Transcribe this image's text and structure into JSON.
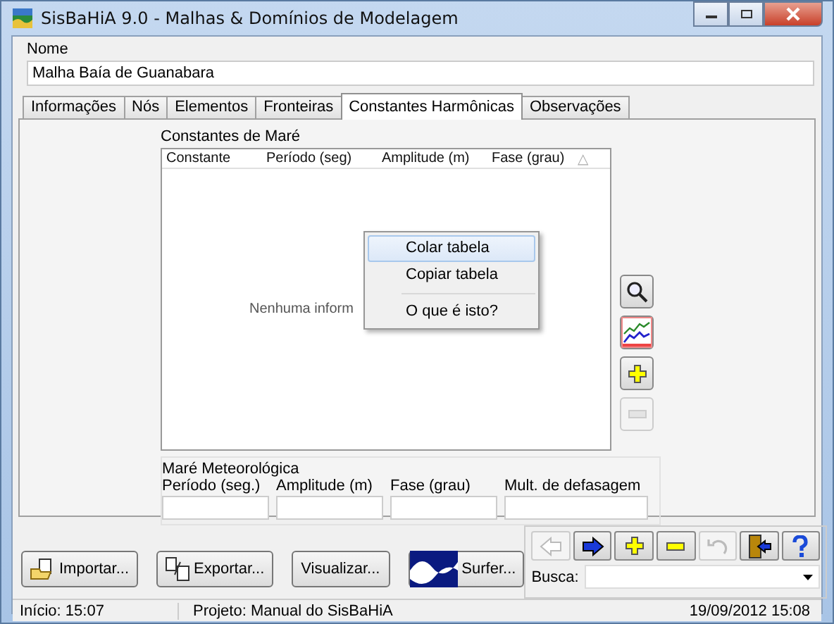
{
  "window": {
    "title": "SisBaHiA 9.0 - Malhas & Domínios de Modelagem"
  },
  "name_field": {
    "label": "Nome",
    "value": "Malha Baía de Guanabara"
  },
  "tabs": [
    {
      "label": "Informações",
      "selected": false
    },
    {
      "label": "Nós",
      "selected": false
    },
    {
      "label": "Elementos",
      "selected": false
    },
    {
      "label": "Fronteiras",
      "selected": false
    },
    {
      "label": "Constantes Harmônicas",
      "selected": true
    },
    {
      "label": "Observações",
      "selected": false
    }
  ],
  "tide_constants": {
    "title": "Constantes de Maré",
    "columns": [
      "Constante",
      "Período (seg)",
      "Amplitude (m)",
      "Fase (grau)",
      "△"
    ],
    "empty_text": "Nenhuma inform"
  },
  "side_buttons": [
    {
      "kind": "search",
      "disabled": false
    },
    {
      "kind": "chart",
      "disabled": false
    },
    {
      "kind": "add",
      "disabled": false
    },
    {
      "kind": "remove",
      "disabled": true
    }
  ],
  "context_menu": [
    {
      "label": "Colar tabela",
      "selected": true,
      "divider_above": false
    },
    {
      "label": "Copiar tabela",
      "selected": false,
      "divider_above": false
    },
    {
      "label": "O que é isto?",
      "selected": false,
      "divider_above": true
    }
  ],
  "meteorological": {
    "title": "Maré Meteorológica",
    "fields": [
      {
        "label": "Período (seg.)"
      },
      {
        "label": "Amplitude (m)"
      },
      {
        "label": "Fase (grau)"
      },
      {
        "label": "Mult. de defasagem"
      }
    ]
  },
  "action_buttons": [
    {
      "label": "Importar...",
      "kind": "import"
    },
    {
      "label": "Exportar...",
      "kind": "export"
    },
    {
      "label": "Visualizar...",
      "kind": "plain"
    },
    {
      "label": "Surfer...",
      "kind": "surfer"
    }
  ],
  "nav_buttons": [
    {
      "kind": "back",
      "disabled": true
    },
    {
      "kind": "forward",
      "disabled": false
    },
    {
      "kind": "add",
      "disabled": false
    },
    {
      "kind": "remove",
      "disabled": false
    },
    {
      "kind": "undo",
      "disabled": true
    },
    {
      "kind": "exit",
      "disabled": false
    },
    {
      "kind": "help",
      "disabled": false
    }
  ],
  "search": {
    "label": "Busca:"
  },
  "status_bar": [
    "Início: 15:07",
    "Projeto: Manual do SisBaHiA",
    "19/09/2012 15:08"
  ]
}
